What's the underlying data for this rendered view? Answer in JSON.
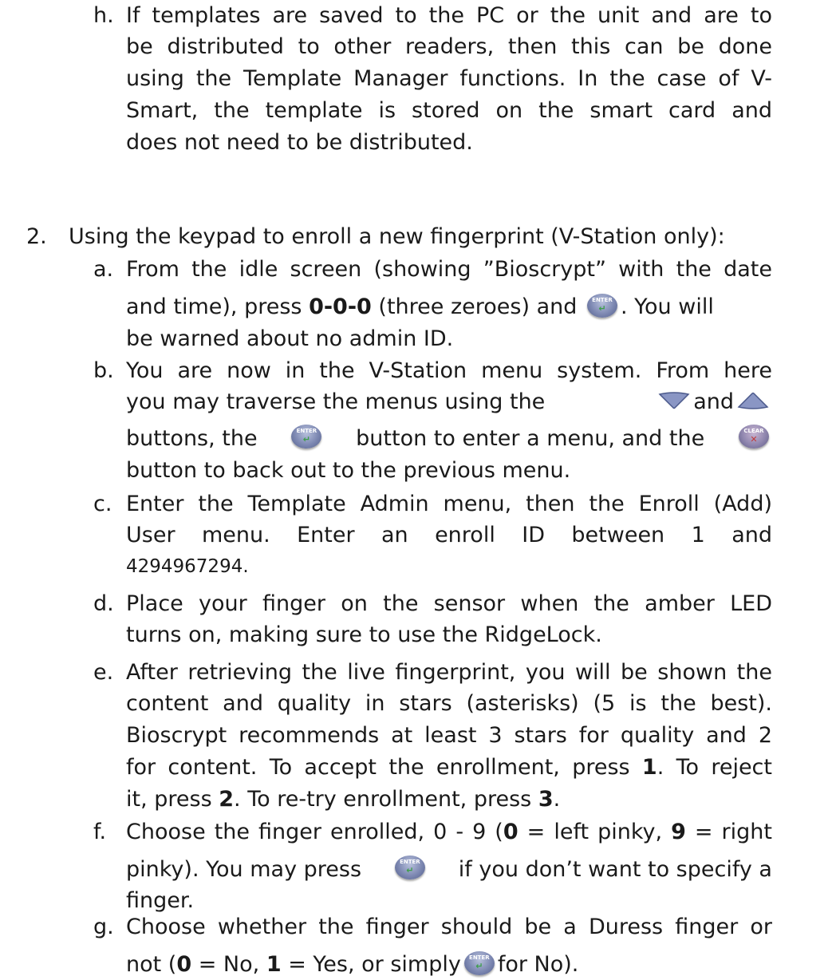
{
  "h": {
    "label": "h.",
    "line1": "If templates are saved to the PC or the unit and are to",
    "line2": "be distributed to other readers, then this can be done",
    "line3": "using the Template Manager functions.  In the case of V-",
    "line4": "Smart, the template is stored on the smart card and",
    "line5": "does not need to be distributed."
  },
  "step2": {
    "label": "2.",
    "text": "Using the keypad to enroll a new fingerprint (V-Station only):"
  },
  "a": {
    "label": "a.",
    "line1": "From the idle screen (showing ”Bioscrypt” with the date",
    "line2_pre": "and time), press ",
    "line2_bold": "0-0-0",
    "line2_mid": " (three zeroes) and ",
    "line2_post": ".  You will",
    "line3": "be warned about no admin ID."
  },
  "b": {
    "label": "b.",
    "line1": "You are now in the V-Station menu system.  From here",
    "line2_pre": "you may traverse the menus using the",
    "line2_mid": "and",
    "line3_pre": "buttons, the",
    "line3_mid": "button to enter a menu, and the",
    "line4": "button to back out to the previous menu."
  },
  "c": {
    "label": "c.",
    "line1": "Enter the Template Admin menu, then the Enroll (Add)",
    "line2": "User menu.    Enter an enroll ID between 1 and",
    "line3": "4294967294."
  },
  "d": {
    "label": "d.",
    "line1": "Place your finger on the sensor when the amber LED",
    "line2": "turns on, making sure to use the RidgeLock."
  },
  "e": {
    "label": "e.",
    "line1": "After retrieving the live fingerprint, you will be shown the",
    "line2": "content and quality in stars (asterisks) (5 is the best).",
    "line3": "Bioscrypt recommends at least 3 stars for quality and 2",
    "line4_pre": "for content.  To accept the enrollment, press ",
    "line4_b1": "1",
    "line4_post": ".  To reject",
    "line5_pre": "it, press ",
    "line5_b1": "2",
    "line5_mid": ".  To re-try enrollment, press ",
    "line5_b2": "3",
    "line5_post": "."
  },
  "f": {
    "label": "f.",
    "line1_pre": "Choose the finger enrolled, 0 - 9 (",
    "line1_b1": "0",
    "line1_mid": " = left pinky, ",
    "line1_b2": "9",
    "line1_post": " = right",
    "line2_pre": "pinky).  You may press",
    "line2_post": "if you don’t want to specify a",
    "line3": "finger."
  },
  "g": {
    "label": "g.",
    "line1": "Choose whether the finger should be a Duress finger or",
    "line2_pre": "not (",
    "line2_b1": "0",
    "line2_mid1": " = No, ",
    "line2_b2": "1",
    "line2_mid2": " = Yes, or simply",
    "line2_post": "for No)."
  },
  "icons": {
    "enter_caption": "ENTER",
    "clear_caption": "CLEAR",
    "enter_mark": "↵",
    "clear_mark": "✕"
  }
}
